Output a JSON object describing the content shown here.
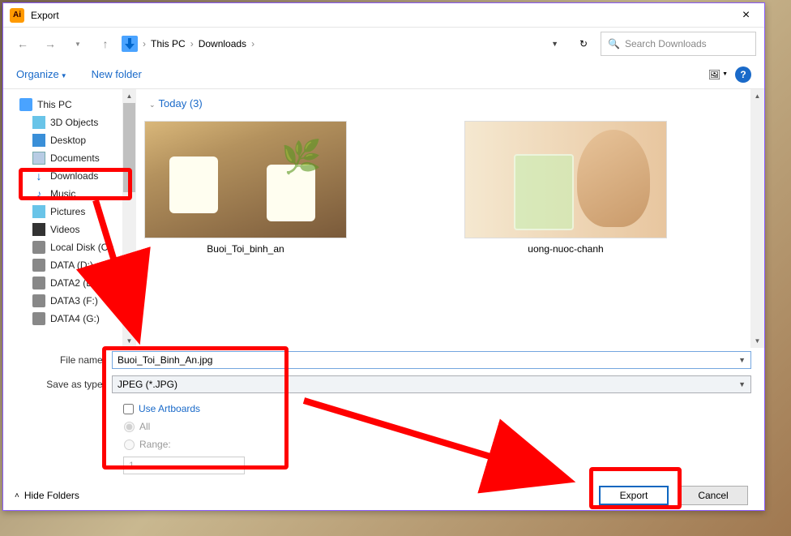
{
  "titlebar": {
    "title": "Export"
  },
  "breadcrumbs": {
    "pc": "This PC",
    "folder": "Downloads"
  },
  "search": {
    "placeholder": "Search Downloads"
  },
  "toolbar": {
    "organize": "Organize",
    "newfolder": "New folder",
    "help": "?"
  },
  "tree": {
    "items": [
      {
        "label": "This PC",
        "icon": "pc",
        "level": 0
      },
      {
        "label": "3D Objects",
        "icon": "cube",
        "level": 1
      },
      {
        "label": "Desktop",
        "icon": "desk",
        "level": 1
      },
      {
        "label": "Documents",
        "icon": "doc",
        "level": 1
      },
      {
        "label": "Downloads",
        "icon": "down",
        "level": 1,
        "selected": true
      },
      {
        "label": "Music",
        "icon": "music",
        "level": 1
      },
      {
        "label": "Pictures",
        "icon": "pic",
        "level": 1
      },
      {
        "label": "Videos",
        "icon": "vid",
        "level": 1
      },
      {
        "label": "Local Disk (C:)",
        "icon": "disk",
        "level": 1
      },
      {
        "label": "DATA (D:)",
        "icon": "disk",
        "level": 1
      },
      {
        "label": "DATA2 (E:)",
        "icon": "disk",
        "level": 1
      },
      {
        "label": "DATA3 (F:)",
        "icon": "disk",
        "level": 1
      },
      {
        "label": "DATA4 (G:)",
        "icon": "disk",
        "level": 1
      }
    ]
  },
  "group_header": "Today (3)",
  "thumbs": [
    {
      "label": "Buoi_Toi_binh_an",
      "variant": "candles"
    },
    {
      "label": "uong-nuoc-chanh",
      "variant": "drink"
    }
  ],
  "filename": {
    "label": "File name:",
    "value": "Buoi_Toi_Binh_An.jpg"
  },
  "savetype": {
    "label": "Save as type:",
    "value": "JPEG (*.JPG)"
  },
  "options": {
    "use_artboards": "Use Artboards",
    "all": "All",
    "range": "Range:",
    "range_value": "1"
  },
  "actions": {
    "hide_folders": "Hide Folders",
    "export": "Export",
    "cancel": "Cancel"
  }
}
